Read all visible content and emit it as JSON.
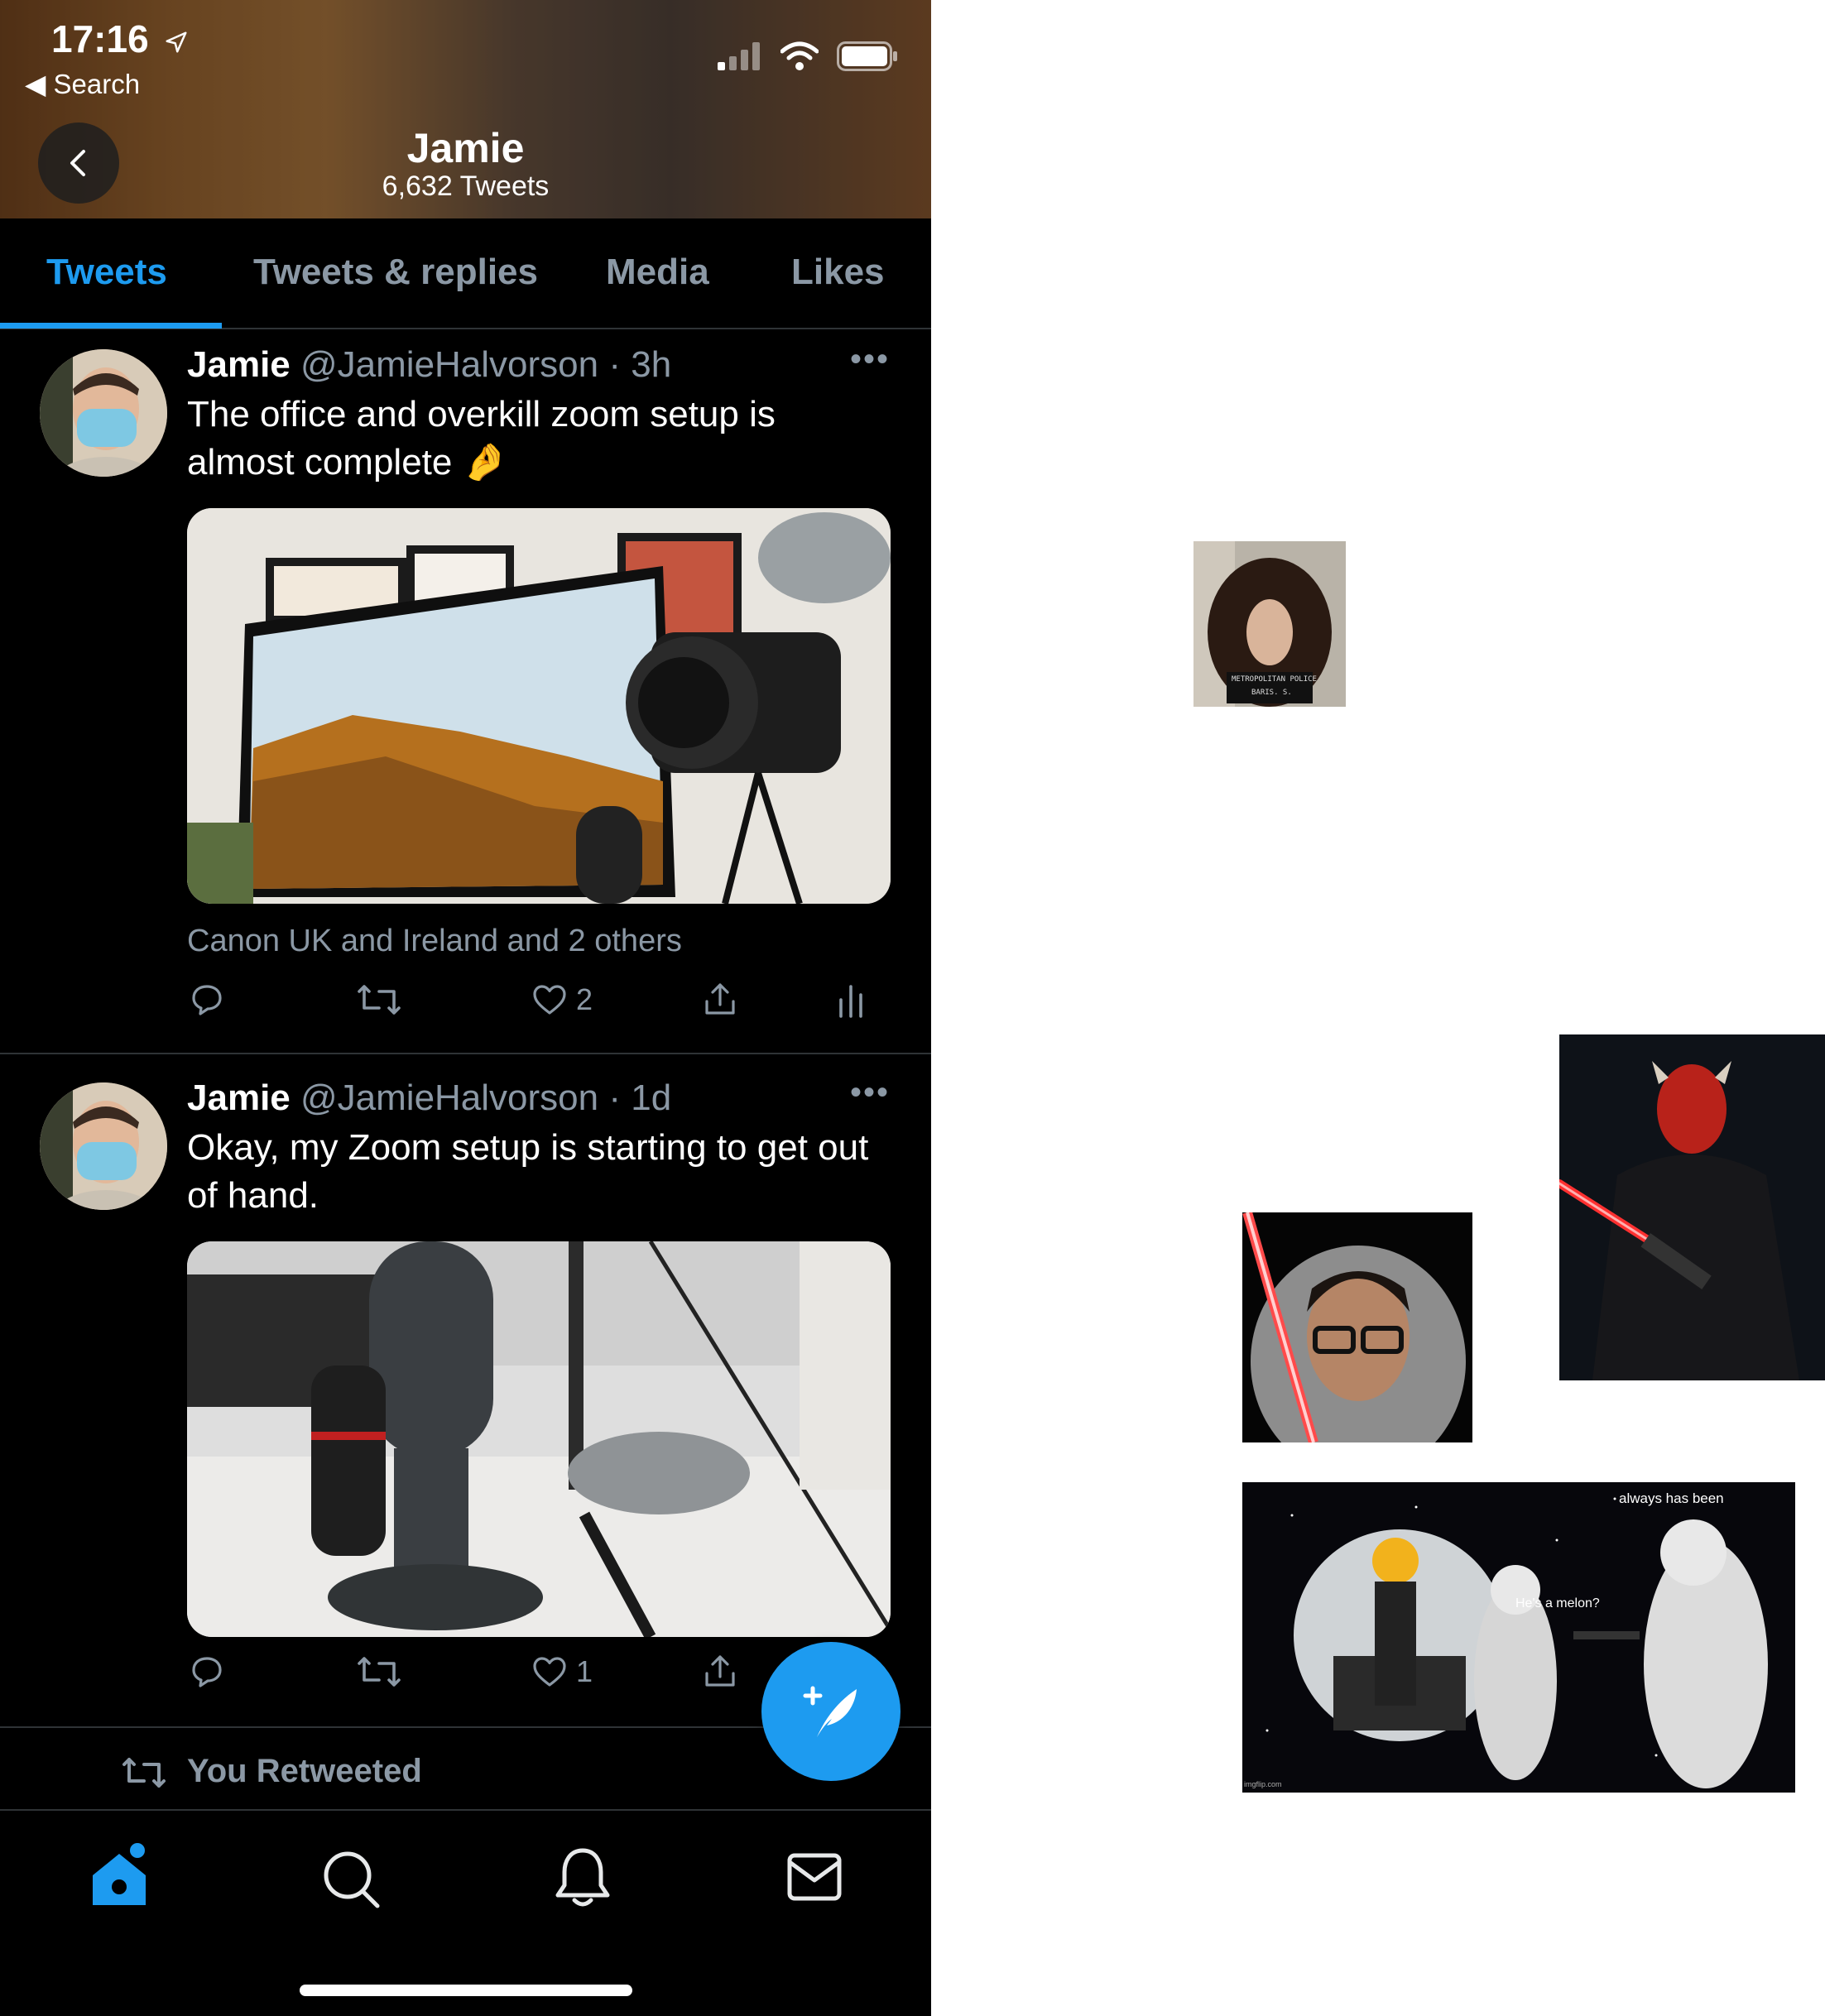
{
  "status_bar": {
    "time": "17:16",
    "back_app": "Search"
  },
  "profile": {
    "name": "Jamie",
    "tweet_count": "6,632 Tweets"
  },
  "tabs": [
    {
      "label": "Tweets",
      "active": true
    },
    {
      "label": "Tweets & replies",
      "active": false
    },
    {
      "label": "Media",
      "active": false
    },
    {
      "label": "Likes",
      "active": false
    }
  ],
  "tweets": [
    {
      "name": "Jamie",
      "handle": "@JamieHalvorson",
      "time": "· 3h",
      "text": "The office and overkill zoom setup is almost complete 🤌",
      "tagged": "Canon UK and Ireland and 2 others",
      "likes": "2"
    },
    {
      "name": "Jamie",
      "handle": "@JamieHalvorson",
      "time": "· 1d",
      "text": "Okay, my Zoom setup is starting to get out of hand.",
      "likes": "1"
    }
  ],
  "retweet_banner": "You Retweeted",
  "floating_images": {
    "mugshot_caption": "METROPOLITAN POLICE",
    "mugshot_name": "BARIS. S.",
    "meme_text_1": "always has been",
    "meme_text_2": "He's a melon?",
    "meme_watermark": "imgflip.com"
  },
  "colors": {
    "accent": "#1d9bf0",
    "muted": "#8b98a5",
    "divider": "#2f3336"
  }
}
